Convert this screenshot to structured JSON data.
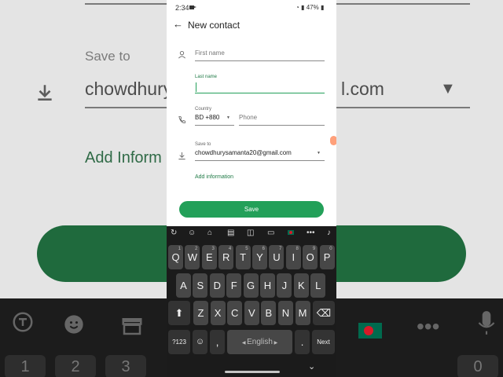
{
  "status": {
    "time": "2:34",
    "battery": "47%"
  },
  "header": {
    "title": "New contact"
  },
  "form": {
    "first_name_placeholder": "First name",
    "last_name_label": "Last name",
    "country_label": "Country",
    "country_value": "BD +880",
    "phone_placeholder": "Phone",
    "save_to_label": "Save to",
    "save_to_value": "chowdhurysamanta20@gmail.com",
    "add_info": "Add information",
    "save_button": "Save"
  },
  "background": {
    "save_to": "Save to",
    "account_start": "chowdhury",
    "account_end": "l.com",
    "add_info": "Add Inform",
    "numbers": [
      "1",
      "2",
      "3",
      "0"
    ]
  },
  "keyboard": {
    "row1": [
      {
        "key": "Q",
        "num": "1"
      },
      {
        "key": "W",
        "num": "2"
      },
      {
        "key": "E",
        "num": "3"
      },
      {
        "key": "R",
        "num": "4"
      },
      {
        "key": "T",
        "num": "5"
      },
      {
        "key": "Y",
        "num": "6"
      },
      {
        "key": "U",
        "num": "7"
      },
      {
        "key": "I",
        "num": "8"
      },
      {
        "key": "O",
        "num": "9"
      },
      {
        "key": "P",
        "num": "0"
      }
    ],
    "row2": [
      "A",
      "S",
      "D",
      "F",
      "G",
      "H",
      "J",
      "K",
      "L"
    ],
    "row3": [
      "Z",
      "X",
      "C",
      "V",
      "B",
      "N",
      "M"
    ],
    "symbols_key": "?123",
    "comma_key": ",",
    "space_label": "English",
    "period_key": ".",
    "next_key": "Next"
  },
  "colors": {
    "accent_green": "#23a059",
    "label_green": "#1f7a46"
  }
}
